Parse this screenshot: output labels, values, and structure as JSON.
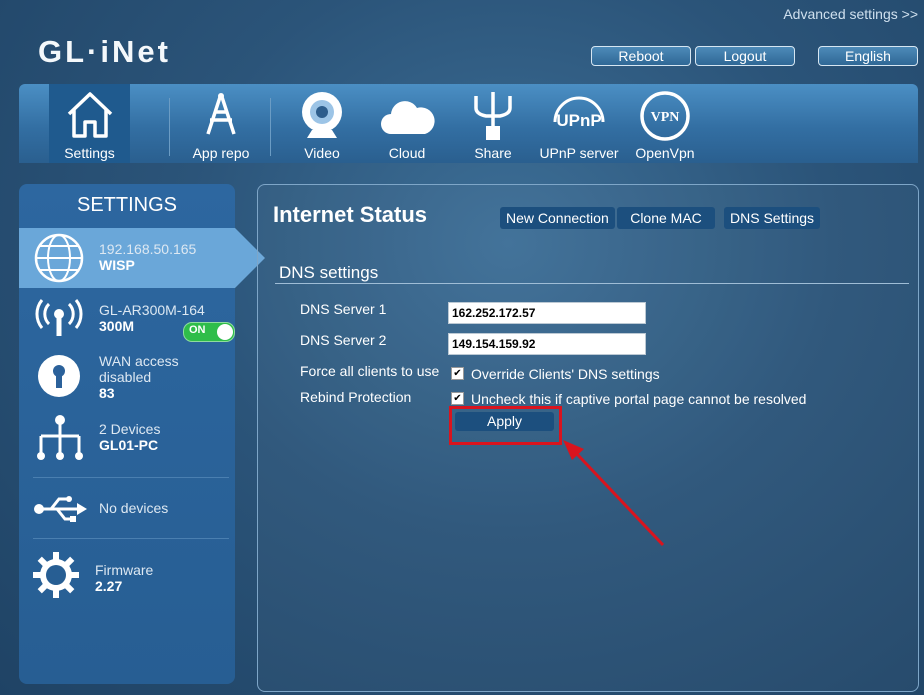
{
  "header": {
    "advanced_link": "Advanced settings >>",
    "logo": "GL·iNet",
    "buttons": {
      "reboot": "Reboot",
      "logout": "Logout",
      "language": "English"
    }
  },
  "toolbar": {
    "items": [
      {
        "label": "Settings",
        "icon": "home-icon",
        "active": true
      },
      {
        "label": "App repo",
        "icon": "app-repo-icon"
      },
      {
        "label": "Video",
        "icon": "webcam-icon"
      },
      {
        "label": "Cloud",
        "icon": "cloud-icon"
      },
      {
        "label": "Share",
        "icon": "usb-share-icon"
      },
      {
        "label": "UPnP server",
        "icon": "upnp-icon",
        "icon_text": "UPnP"
      },
      {
        "label": "OpenVpn",
        "icon": "vpn-icon",
        "icon_text": "VPN"
      }
    ]
  },
  "sidebar": {
    "title": "SETTINGS",
    "items": [
      {
        "line1": "192.168.50.165",
        "line2": "WISP",
        "icon": "globe-icon"
      },
      {
        "line1": "GL-AR300M-164",
        "line2": "300M",
        "icon": "wifi-antenna-icon",
        "toggle": "ON"
      },
      {
        "line1": "WAN access",
        "line1b": "disabled",
        "line2": "83",
        "icon": "keyhole-icon"
      },
      {
        "line1": "2 Devices",
        "line2": "GL01-PC",
        "icon": "network-tree-icon"
      },
      {
        "line1": "No devices",
        "icon": "usb-icon"
      },
      {
        "line1": "Firmware",
        "line2": "2.27",
        "icon": "gear-icon"
      }
    ]
  },
  "main": {
    "title": "Internet Status",
    "tabs": {
      "new_connection": "New Connection",
      "clone_mac": "Clone MAC",
      "dns_settings": "DNS Settings"
    },
    "section_title": "DNS settings",
    "dns1": {
      "label": "DNS Server 1",
      "value": "162.252.172.57"
    },
    "dns2": {
      "label": "DNS Server 2",
      "value": "149.154.159.92"
    },
    "force": {
      "label": "Force all clients to use",
      "checkbox_label": "Override Clients' DNS settings",
      "checked": true
    },
    "rebind": {
      "label": "Rebind Protection",
      "checkbox_label": "Uncheck this if captive portal page cannot be resolved",
      "checked": true
    },
    "apply": "Apply"
  },
  "colors": {
    "highlight": "#d9141e",
    "toggle_on": "#2fbd4a",
    "selected_item": "#6aa7d9"
  }
}
